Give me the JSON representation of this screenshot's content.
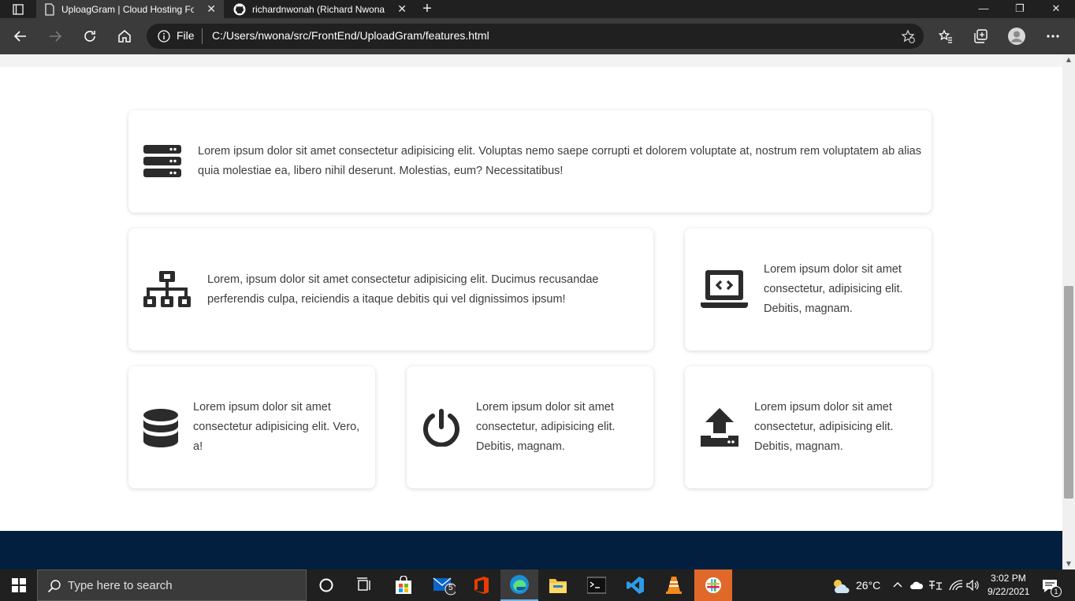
{
  "browser": {
    "tabs": [
      {
        "title": "UploagGram | Cloud Hosting For",
        "close": "✕",
        "active": true
      },
      {
        "title": "richardnwonah (Richard Nwonah",
        "close": "✕",
        "active": false
      }
    ],
    "new_tab": "+",
    "address": {
      "scheme_label": "File",
      "url": "C:/Users/nwona/src/FrontEnd/UploadGram/features.html"
    },
    "window_controls": {
      "minimize": "—",
      "restore": "❐",
      "close": "✕"
    }
  },
  "features": [
    {
      "icon": "server-icon",
      "text": "Lorem ipsum dolor sit amet consectetur adipisicing elit. Voluptas nemo saepe corrupti et dolorem voluptate at, nostrum rem voluptatem ab alias quia molestiae ea, libero nihil deserunt. Molestias, eum? Necessitatibus!"
    },
    {
      "icon": "network-icon",
      "text": "Lorem, ipsum dolor sit amet consectetur adipisicing elit. Ducimus recusandae perferendis culpa, reiciendis a itaque debitis qui vel dignissimos ipsum!"
    },
    {
      "icon": "laptop-code-icon",
      "text": "Lorem ipsum dolor sit amet consectetur, adipisicing elit. Debitis, magnam."
    },
    {
      "icon": "database-icon",
      "text": "Lorem ipsum dolor sit amet consectetur adipisicing elit. Vero, a!"
    },
    {
      "icon": "power-icon",
      "text": "Lorem ipsum dolor sit amet consectetur, adipisicing elit. Debitis, magnam."
    },
    {
      "icon": "upload-icon",
      "text": "Lorem ipsum dolor sit amet consectetur, adipisicing elit. Debitis, magnam."
    }
  ],
  "taskbar": {
    "search_placeholder": "Type here to search",
    "mail_badge": "5",
    "weather": "26°C",
    "time": "3:02 PM",
    "date": "9/22/2021",
    "notification_badge": "1"
  },
  "colors": {
    "footer": "#031f3f",
    "icon": "#2b2b2b",
    "text": "#3d3d3d"
  }
}
